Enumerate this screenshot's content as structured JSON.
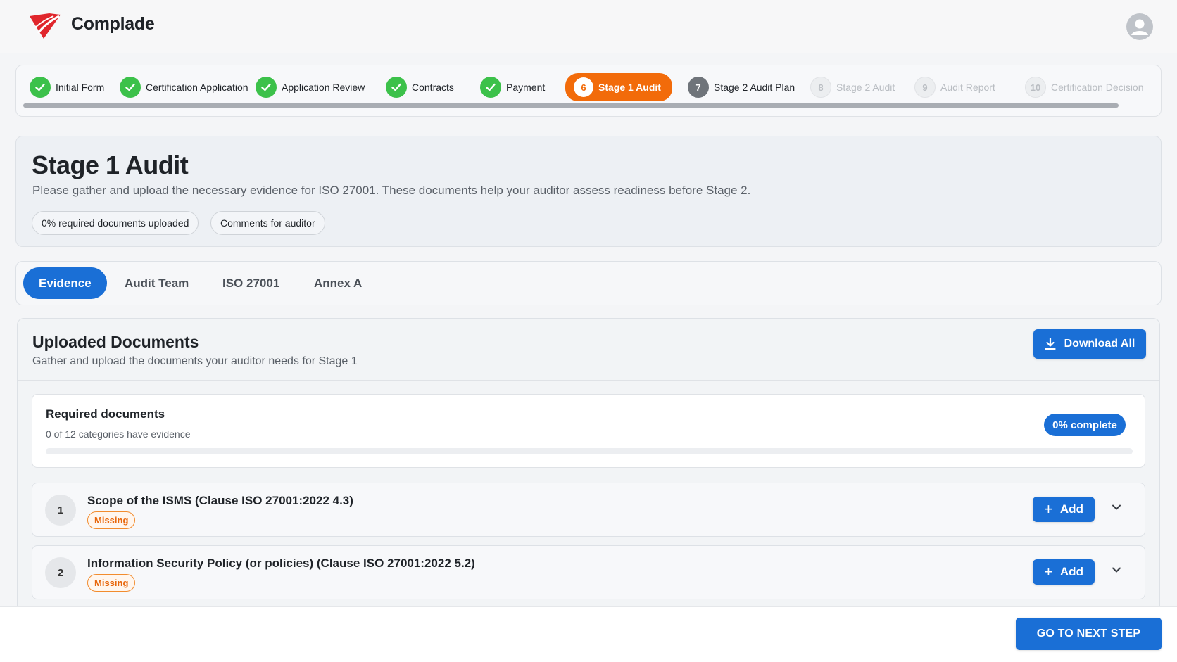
{
  "app": {
    "brand": "Complade",
    "brand_color": "#e0262c",
    "accent": "#1a6fd6",
    "active_step_color": "#f26b0a"
  },
  "stepper": {
    "steps": [
      {
        "number": "1",
        "label": "Initial Form",
        "state": "done"
      },
      {
        "number": "2",
        "label": "Certification Application",
        "state": "done"
      },
      {
        "number": "3",
        "label": "Application Review",
        "state": "done"
      },
      {
        "number": "4",
        "label": "Contracts",
        "state": "done"
      },
      {
        "number": "5",
        "label": "Payment",
        "state": "done"
      },
      {
        "number": "6",
        "label": "Stage 1 Audit",
        "state": "active"
      },
      {
        "number": "7",
        "label": "Stage 2 Audit Plan",
        "state": "next"
      },
      {
        "number": "8",
        "label": "Stage 2 Audit",
        "state": "future"
      },
      {
        "number": "9",
        "label": "Audit Report",
        "state": "future"
      },
      {
        "number": "10",
        "label": "Certification Decision",
        "state": "future"
      }
    ]
  },
  "stage": {
    "title": "Stage 1 Audit",
    "description": "Please gather and upload the necessary evidence for ISO 27001. These documents help your auditor assess readiness before Stage 2.",
    "pill_uploaded": "0% required documents uploaded",
    "pill_comments": "Comments for auditor"
  },
  "tabs": [
    {
      "label": "Evidence",
      "active": true
    },
    {
      "label": "Audit Team",
      "active": false
    },
    {
      "label": "ISO 27001",
      "active": false
    },
    {
      "label": "Annex A",
      "active": false
    }
  ],
  "docs": {
    "title": "Uploaded Documents",
    "subtitle": "Gather and upload the documents your auditor needs for Stage 1",
    "download_label": "Download All",
    "required": {
      "title": "Required documents",
      "summary": "0 of 12 categories have evidence",
      "badge": "0% complete",
      "progress": 0
    },
    "items": [
      {
        "number": "1",
        "title": "Scope of the ISMS (Clause ISO 27001:2022 4.3)",
        "status": "Missing",
        "add_label": "Add"
      },
      {
        "number": "2",
        "title": "Information Security Policy (or policies) (Clause ISO 27001:2022 5.2)",
        "status": "Missing",
        "add_label": "Add"
      }
    ]
  },
  "footer": {
    "next_label": "GO TO NEXT STEP"
  }
}
